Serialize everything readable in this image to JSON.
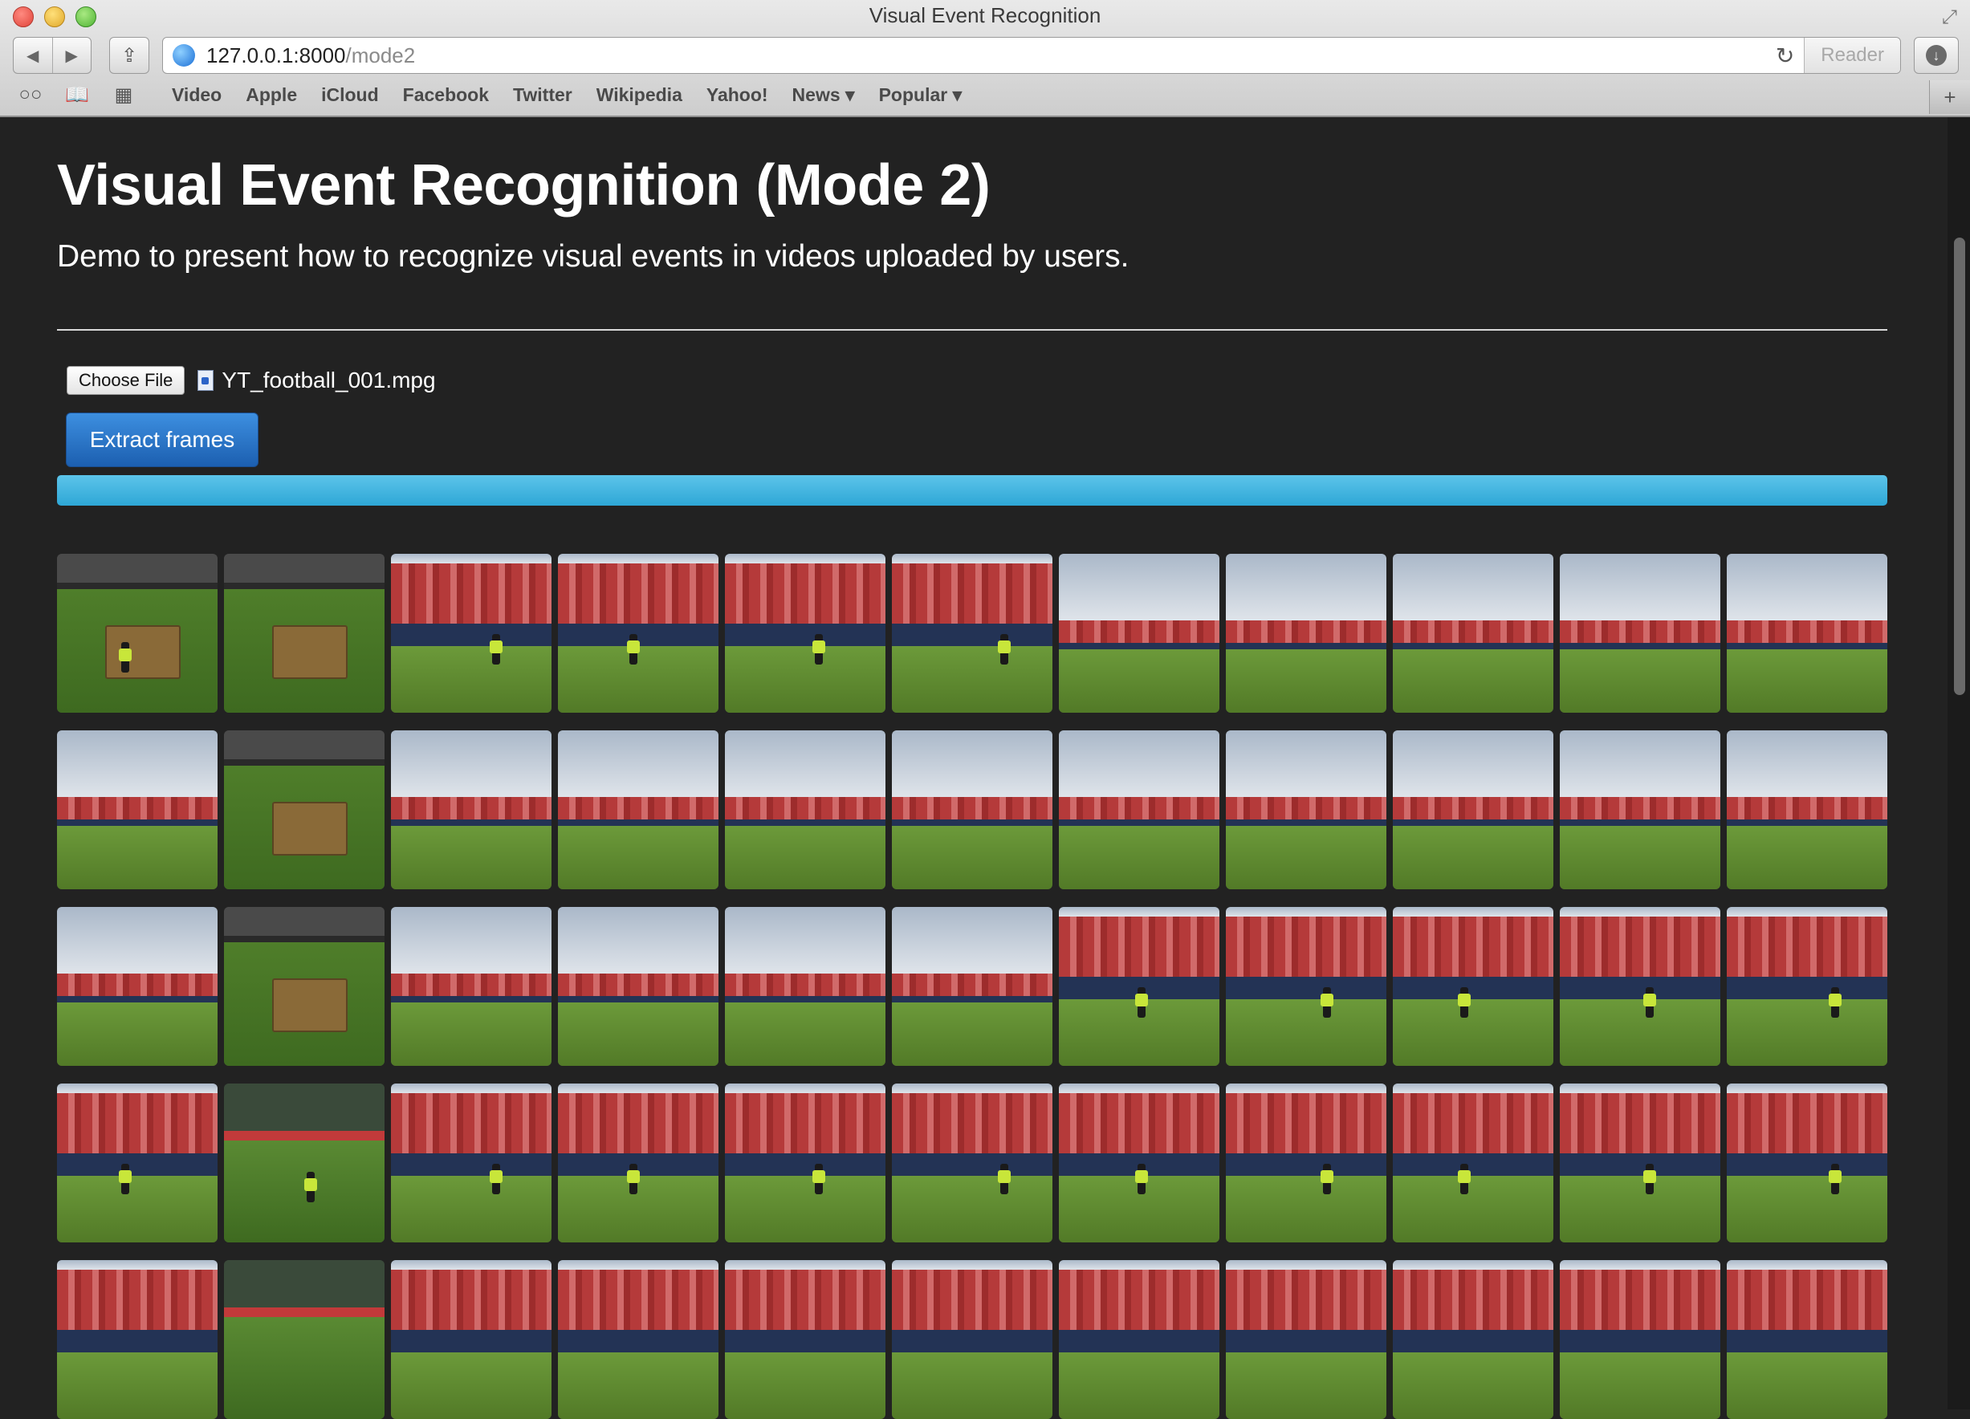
{
  "window": {
    "title": "Visual Event Recognition",
    "url_host": "127.0.0.1:8000",
    "url_path": "/mode2",
    "reader_label": "Reader"
  },
  "bookmarks": [
    {
      "label": "Video"
    },
    {
      "label": "Apple"
    },
    {
      "label": "iCloud"
    },
    {
      "label": "Facebook"
    },
    {
      "label": "Twitter"
    },
    {
      "label": "Wikipedia"
    },
    {
      "label": "Yahoo!"
    },
    {
      "label": "News ▾"
    },
    {
      "label": "Popular ▾"
    }
  ],
  "page": {
    "title": "Visual Event Recognition (Mode 2)",
    "lead": "Demo to present how to recognize visual events in videos uploaded by users.",
    "choose_file_label": "Choose File",
    "file_name": "YT_football_001.mpg",
    "extract_button_label": "Extract frames",
    "progress_fraction": 1.0
  },
  "frames": {
    "rows": [
      [
        "close",
        "close",
        "stands",
        "stands",
        "stands",
        "stands",
        "wide",
        "wide",
        "wide",
        "wide",
        "wide"
      ],
      [
        "wide",
        "close",
        "wide",
        "wide",
        "wide",
        "wide",
        "wide",
        "wide",
        "wide",
        "wide",
        "wide"
      ],
      [
        "wide",
        "close",
        "wide",
        "wide",
        "wide",
        "wide",
        "stands",
        "stands",
        "stands",
        "stands",
        "stands"
      ],
      [
        "stands",
        "dark",
        "stands",
        "stands",
        "stands",
        "stands",
        "stands",
        "stands",
        "stands",
        "stands",
        "stands"
      ],
      [
        "stands",
        "dark",
        "stands",
        "stands",
        "stands",
        "stands",
        "stands",
        "stands",
        "stands",
        "stands",
        "stands"
      ]
    ],
    "figures": [
      [
        1,
        0,
        1,
        1,
        1,
        1,
        0,
        0,
        0,
        0,
        0
      ],
      [
        0,
        0,
        0,
        0,
        0,
        0,
        0,
        0,
        0,
        0,
        0
      ],
      [
        0,
        0,
        0,
        0,
        0,
        0,
        1,
        1,
        1,
        1,
        1
      ],
      [
        1,
        1,
        1,
        1,
        1,
        1,
        1,
        1,
        1,
        1,
        1
      ],
      [
        0,
        0,
        0,
        0,
        0,
        0,
        0,
        0,
        0,
        0,
        0
      ]
    ]
  },
  "icons": {
    "back": "back-arrow-icon",
    "forward": "forward-arrow-icon",
    "share": "share-icon",
    "globe": "globe-icon",
    "reload": "reload-icon",
    "download": "download-icon",
    "reading_list": "reading-list-icon",
    "bookmarks": "bookmarks-book-icon",
    "top_sites": "top-sites-grid-icon",
    "new_tab": "plus-icon"
  },
  "colors": {
    "page_background": "#222222",
    "primary_button": "#2a78cc",
    "progress": "#3bb1de"
  }
}
